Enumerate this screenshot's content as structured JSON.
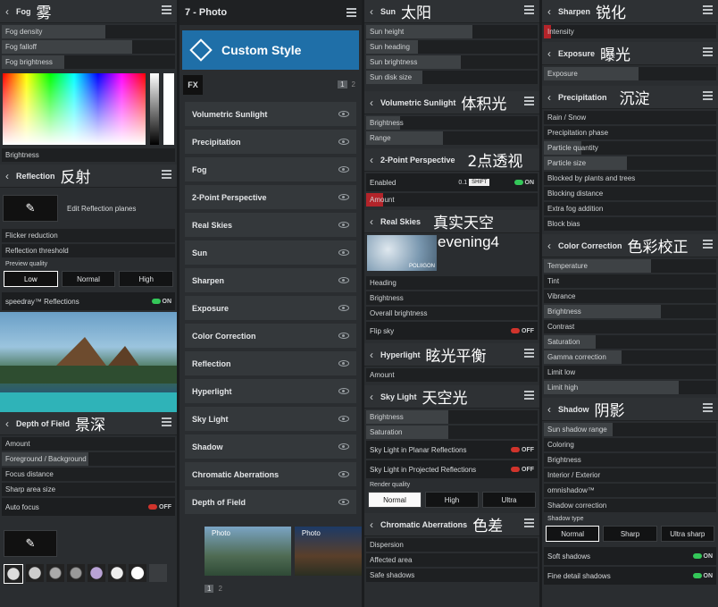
{
  "fog": {
    "title": "Fog",
    "cn": "雾",
    "sliders": [
      "Fog density",
      "Fog falloff",
      "Fog brightness"
    ],
    "brightness": "Brightness"
  },
  "reflection": {
    "title": "Reflection",
    "cn": "反射",
    "edit": "Edit Reflection planes",
    "sliders": [
      "Flicker reduction",
      "Reflection threshold"
    ],
    "quality_label": "Preview quality",
    "quality": [
      "Low",
      "Normal",
      "High"
    ],
    "speedray": "speedray™ Reflections",
    "speedray_state": "ON"
  },
  "dof": {
    "title": "Depth of Field",
    "cn": "景深",
    "sliders": [
      "Amount",
      "Foreground / Background",
      "Focus distance",
      "Sharp area size"
    ],
    "autofocus": "Auto focus",
    "autofocus_state": "OFF"
  },
  "photo": {
    "title": "7 - Photo",
    "style": "Custom Style",
    "fx": "FX",
    "page": [
      "1",
      "2"
    ],
    "items": [
      "Volumetric Sunlight",
      "Precipitation",
      "Fog",
      "2-Point Perspective",
      "Real Skies",
      "Sun",
      "Sharpen",
      "Exposure",
      "Color Correction",
      "Reflection",
      "Hyperlight",
      "Sky Light",
      "Shadow",
      "Chromatic Aberrations",
      "Depth of Field"
    ],
    "thumbs": [
      "Photo",
      "Photo"
    ],
    "bottom_page": [
      "1",
      "2"
    ]
  },
  "sun": {
    "title": "Sun",
    "cn": "太阳",
    "sliders": [
      "Sun height",
      "Sun heading",
      "Sun brightness",
      "Sun disk size"
    ]
  },
  "vol": {
    "title": "Volumetric Sunlight",
    "cn": "体积光",
    "sliders": [
      "Brightness",
      "Range"
    ]
  },
  "persp": {
    "title": "2-Point Perspective",
    "cn": "2点透视",
    "enabled": "Enabled",
    "enabled_state": "ON",
    "value": "0.1",
    "shift": "SHIFT",
    "amount": "Amount"
  },
  "skies": {
    "title": "Real Skies",
    "cn": "真实天空",
    "preset": "evening4",
    "logo": "POLIIGON",
    "sliders": [
      "Heading",
      "Brightness",
      "Overall brightness"
    ],
    "flip": "Flip sky",
    "flip_state": "OFF"
  },
  "hyper": {
    "title": "Hyperlight",
    "cn": "眩光平衡",
    "sliders": [
      "Amount"
    ]
  },
  "skylight": {
    "title": "Sky Light",
    "cn": "天空光",
    "sliders": [
      "Brightness",
      "Saturation"
    ],
    "planar": "Sky Light in Planar Reflections",
    "planar_state": "OFF",
    "projected": "Sky Light in Projected Reflections",
    "projected_state": "OFF",
    "quality_label": "Render quality",
    "quality": [
      "Normal",
      "High",
      "Ultra"
    ]
  },
  "chrom": {
    "title": "Chromatic Aberrations",
    "cn": "色差",
    "sliders": [
      "Dispersion",
      "Affected area",
      "Safe shadows"
    ]
  },
  "sharpen": {
    "title": "Sharpen",
    "cn": "锐化",
    "sliders": [
      "Intensity"
    ]
  },
  "exposure": {
    "title": "Exposure",
    "cn": "曝光",
    "sliders": [
      "Exposure"
    ]
  },
  "precip": {
    "title": "Precipitation",
    "cn": "沉淀",
    "sliders": [
      "Rain / Snow",
      "Precipitation phase",
      "Particle quantity",
      "Particle size",
      "Blocked by plants and trees",
      "Blocking distance",
      "Extra fog addition",
      "Block bias"
    ]
  },
  "cc": {
    "title": "Color Correction",
    "cn": "色彩校正",
    "sliders": [
      "Temperature",
      "Tint",
      "Vibrance",
      "Brightness",
      "Contrast",
      "Saturation",
      "Gamma correction",
      "Limit low",
      "Limit high"
    ]
  },
  "shadow": {
    "title": "Shadow",
    "cn": "阴影",
    "sliders": [
      "Sun shadow range",
      "Coloring",
      "Brightness",
      "Interior / Exterior",
      "omnishadow™",
      "Shadow correction"
    ],
    "type_label": "Shadow type",
    "types": [
      "Normal",
      "Sharp",
      "Ultra sharp"
    ],
    "soft": "Soft shadows",
    "soft_state": "ON",
    "fine": "Fine detail shadows",
    "fine_state": "ON"
  },
  "colors": {
    "accent": "#1f6fa8",
    "on": "#34c759",
    "off": "#d0342c"
  }
}
